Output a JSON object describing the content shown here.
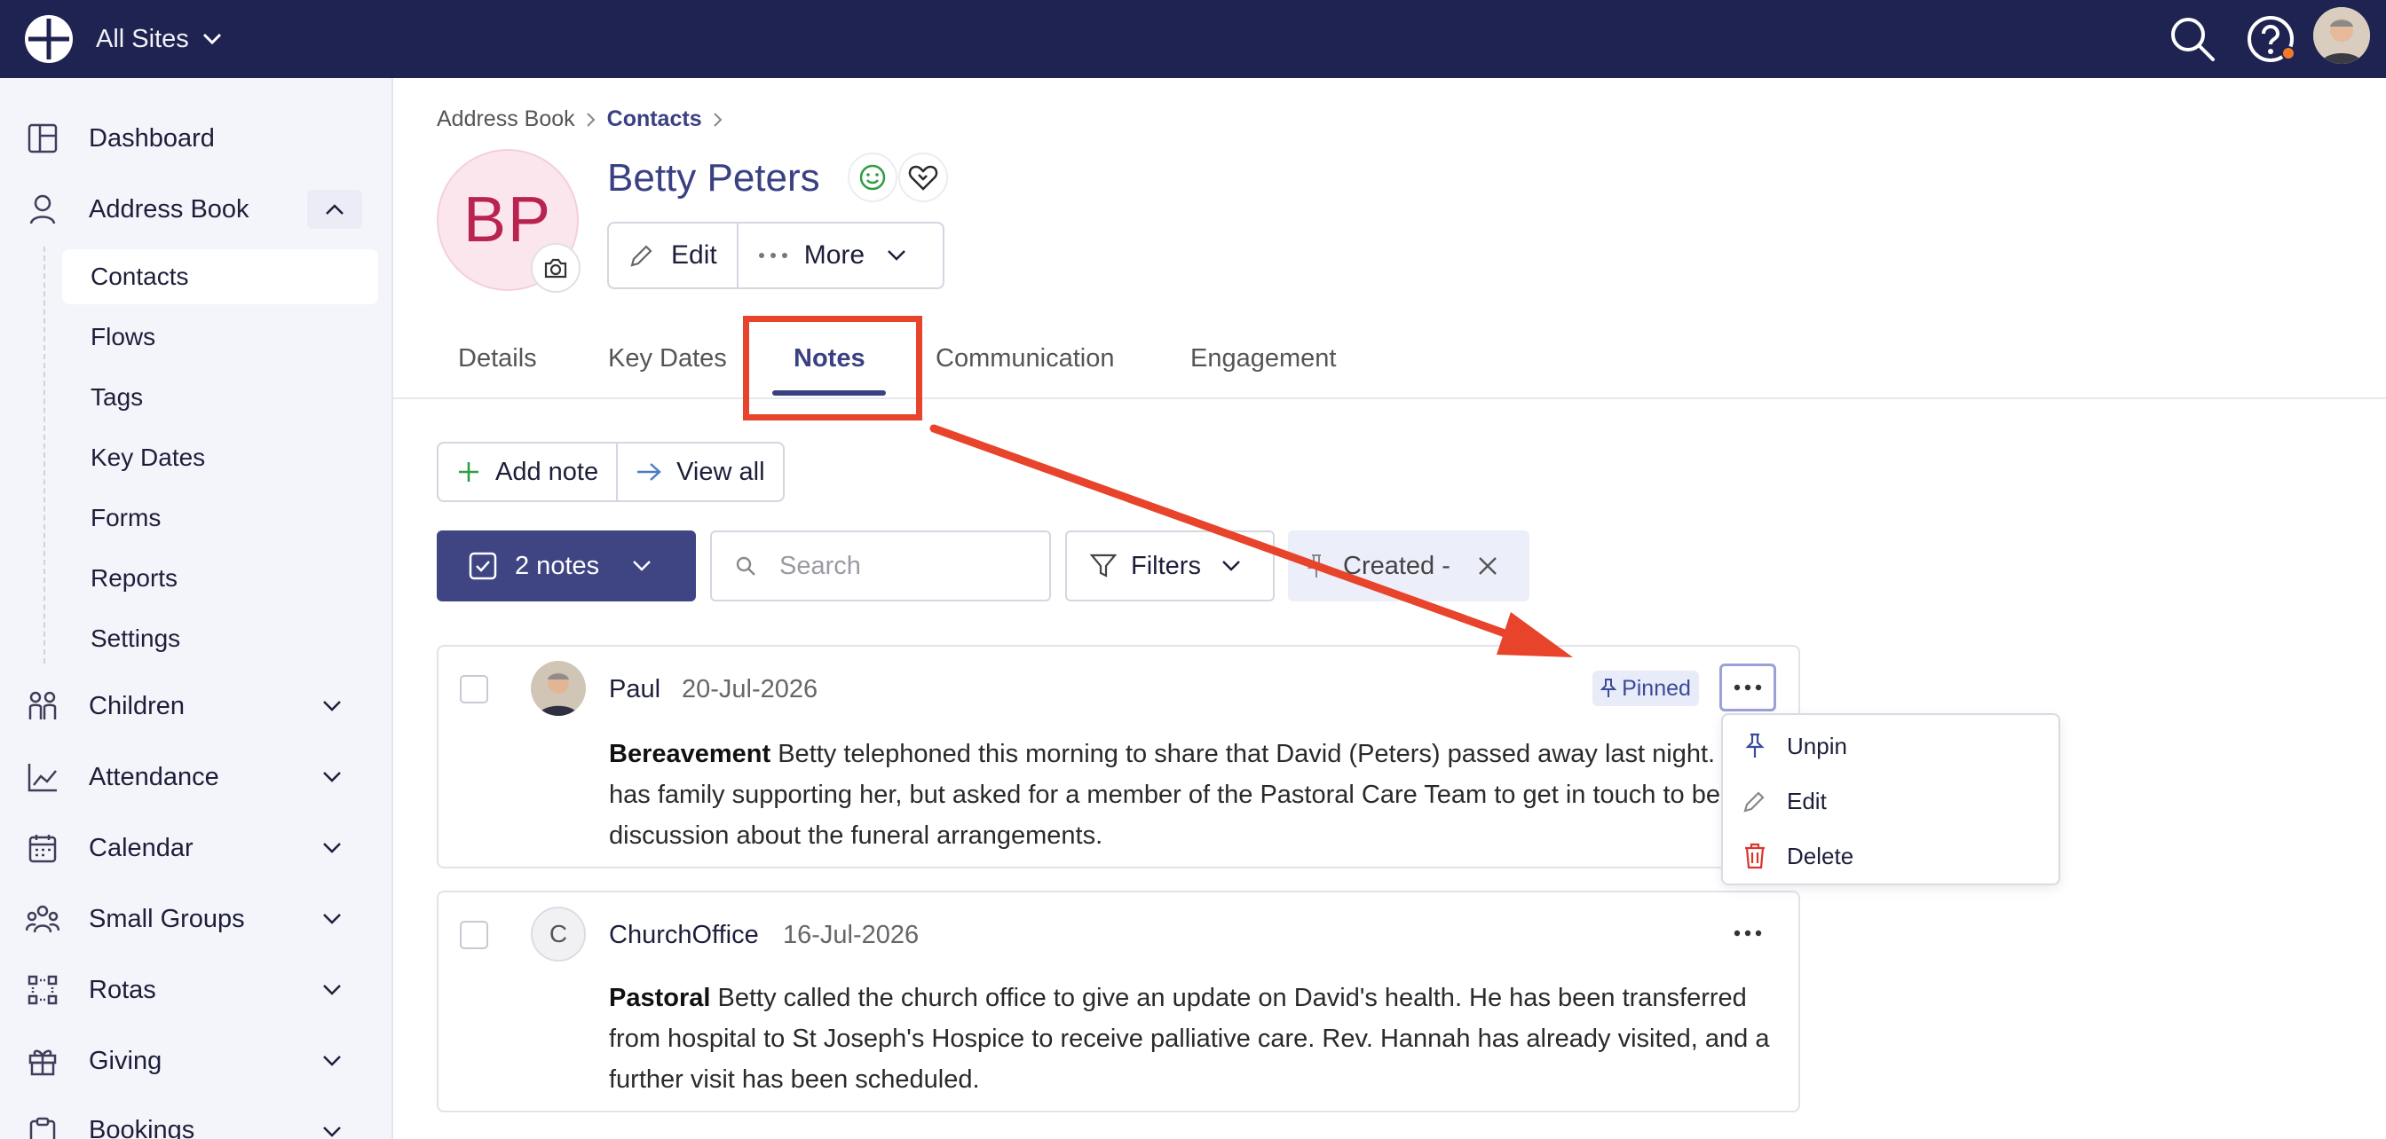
{
  "header": {
    "site_label": "All Sites"
  },
  "sidebar": {
    "items": [
      {
        "label": "Dashboard",
        "icon": "dashboard-icon"
      },
      {
        "label": "Address Book",
        "icon": "person-icon"
      },
      {
        "label": "Children",
        "icon": "children-icon"
      },
      {
        "label": "Attendance",
        "icon": "chart-icon"
      },
      {
        "label": "Calendar",
        "icon": "calendar-icon"
      },
      {
        "label": "Small Groups",
        "icon": "group-icon"
      },
      {
        "label": "Rotas",
        "icon": "rota-icon"
      },
      {
        "label": "Giving",
        "icon": "gift-icon"
      },
      {
        "label": "Bookings",
        "icon": "clipboard-icon"
      }
    ],
    "address_book_sub": [
      "Contacts",
      "Flows",
      "Tags",
      "Key Dates",
      "Forms",
      "Reports",
      "Settings"
    ]
  },
  "breadcrumb": {
    "root": "Address Book",
    "current": "Contacts"
  },
  "profile": {
    "initials": "BP",
    "name": "Betty Peters",
    "edit_label": "Edit",
    "more_label": "More"
  },
  "tabs": [
    "Details",
    "Key Dates",
    "Notes",
    "Communication",
    "Engagement"
  ],
  "active_tab": "Notes",
  "actions": {
    "add_note": "Add note",
    "view_all": "View all"
  },
  "toolbar": {
    "notes_count": "2 notes",
    "search_placeholder": "Search",
    "filters_label": "Filters",
    "sort_label": "Created -"
  },
  "notes": [
    {
      "author": "Paul",
      "date": "20-Jul-2026",
      "pinned_label": "Pinned",
      "category": "Bereavement",
      "body": "Betty telephoned this morning to share that David (Peters) passed away last night. She has family supporting her, but asked for a member of the Pastoral Care Team to get in touch to begin a discussion about the funeral arrangements."
    },
    {
      "author": "ChurchOffice",
      "avatar_initial": "C",
      "date": "16-Jul-2026",
      "category": "Pastoral",
      "body": "Betty called the church office to give an update on David's health. He has been transferred from hospital to St Joseph's Hospice to receive palliative care. Rev. Hannah has already visited, and a further visit has been scheduled."
    }
  ],
  "menu": {
    "unpin": "Unpin",
    "edit": "Edit",
    "delete": "Delete"
  },
  "colors": {
    "topbar": "#1f2352",
    "accent": "#3a4183",
    "annotation": "#e8432b",
    "avatar_text": "#b8244f",
    "delete": "#d9362b"
  }
}
